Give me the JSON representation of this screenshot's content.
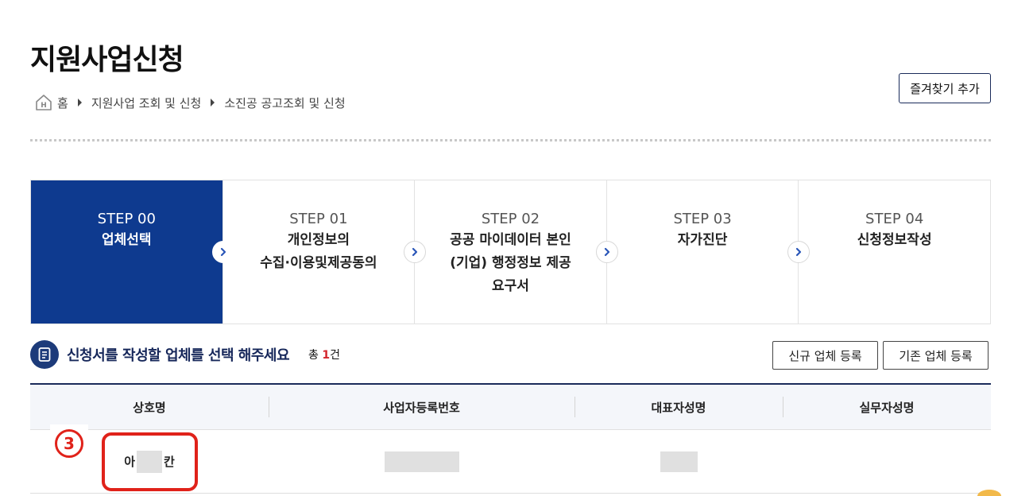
{
  "page": {
    "title": "지원사업신청"
  },
  "breadcrumb": {
    "home": "홈",
    "items": [
      "지원사업 조회 및 신청",
      "소진공 공고조회 및 신청"
    ]
  },
  "favorite_button": "즐겨찾기 추가",
  "steps": [
    {
      "no": "STEP 00",
      "label": "업체선택",
      "active": true
    },
    {
      "no": "STEP 01",
      "label_lines": [
        "개인정보의",
        "수집·이용및제공동의"
      ]
    },
    {
      "no": "STEP 02",
      "label_lines": [
        "공공 마이데이터 본인",
        "(기업) 행정정보 제공",
        "요구서"
      ]
    },
    {
      "no": "STEP 03",
      "label": "자가진단"
    },
    {
      "no": "STEP 04",
      "label": "신청정보작성"
    }
  ],
  "section": {
    "title": "신청서를 작성할 업체를 선택 해주세요",
    "count_prefix": "총 ",
    "count": "1",
    "count_suffix": "건"
  },
  "buttons": {
    "new_company": "신규 업체 등록",
    "existing_company": "기존 업체 등록"
  },
  "table": {
    "headers": [
      "상호명",
      "사업자등록번호",
      "대표자성명",
      "실무자성명"
    ],
    "rows": [
      {
        "company_prefix": "아",
        "company_suffix": "칸"
      }
    ]
  },
  "annotation": {
    "label": "3"
  },
  "colors": {
    "primary": "#0e3a8f",
    "accent_red": "#e0221a",
    "count_red": "#d3262d"
  }
}
